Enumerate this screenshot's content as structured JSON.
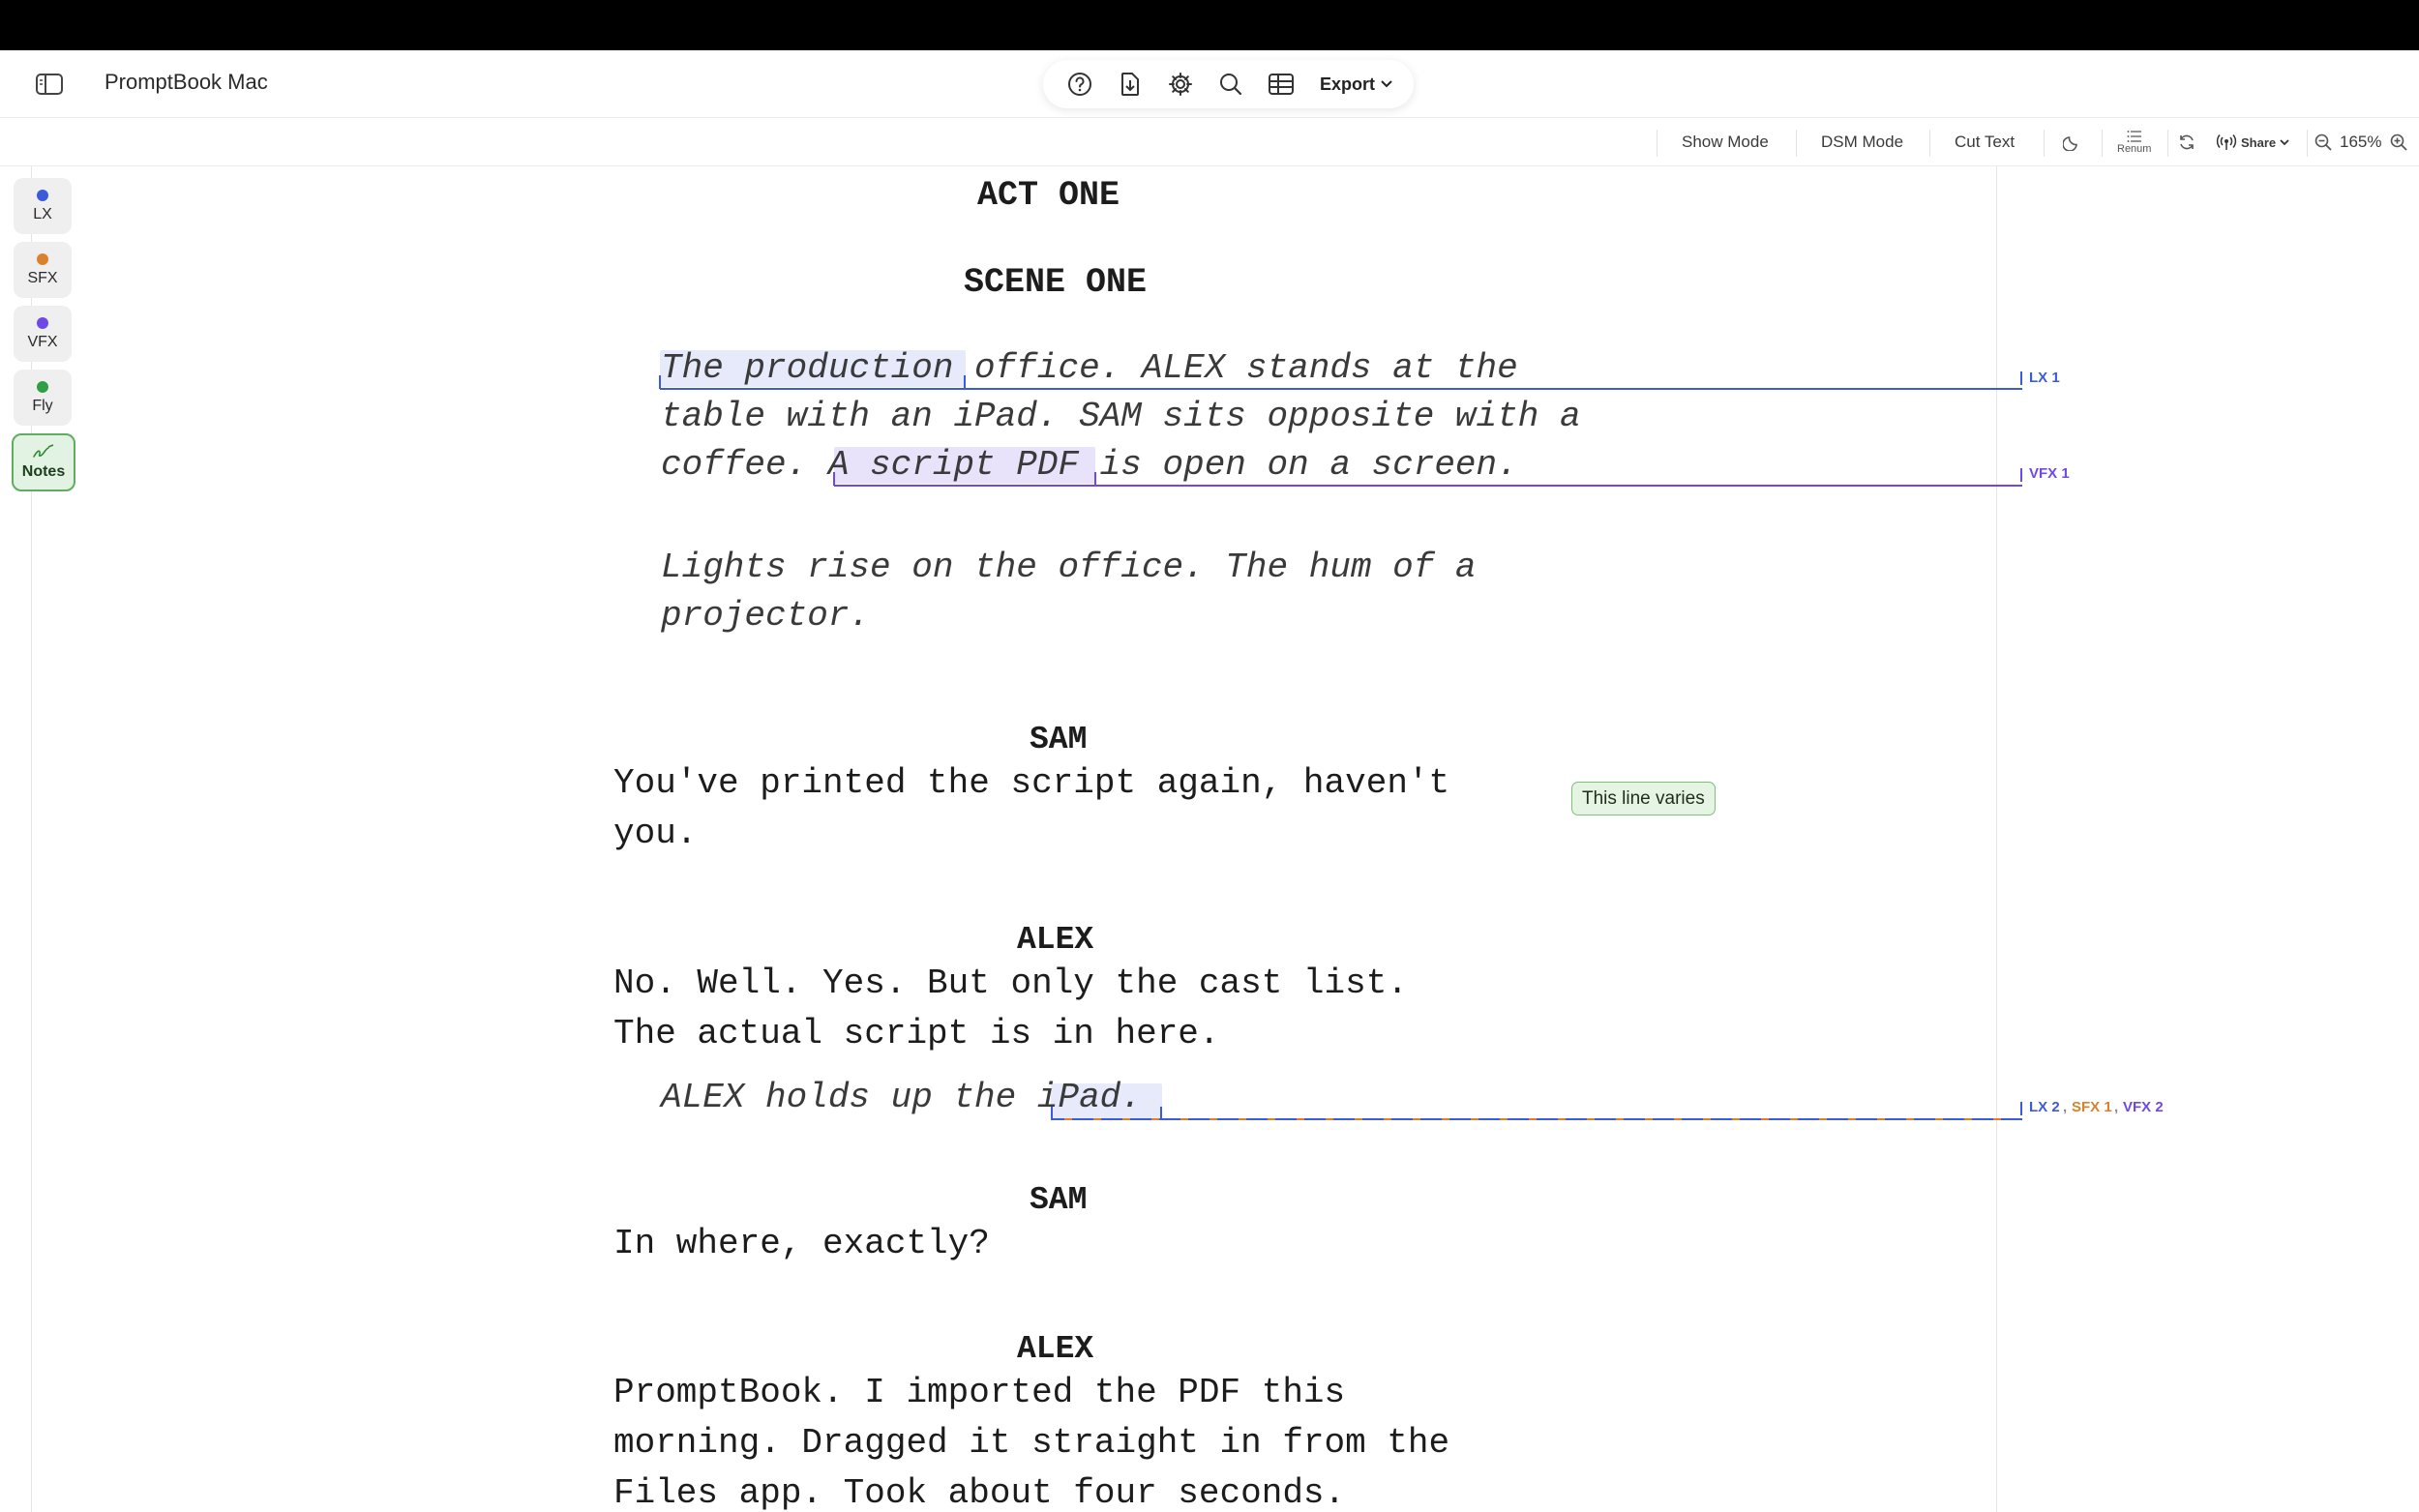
{
  "app": {
    "title": "PromptBook Mac"
  },
  "toolbar": {
    "export_label": "Export",
    "icons": [
      "help-icon",
      "import-icon",
      "gear-icon",
      "search-icon",
      "table-icon"
    ]
  },
  "toolbar2": {
    "show_mode": "Show Mode",
    "dsm_mode": "DSM Mode",
    "cut_text": "Cut Text",
    "renum": "Renum",
    "share": "Share",
    "zoom": "165%"
  },
  "categories": [
    {
      "label": "LX",
      "color": "#3b5bdb"
    },
    {
      "label": "SFX",
      "color": "#d9822b"
    },
    {
      "label": "VFX",
      "color": "#7048e8"
    },
    {
      "label": "Fly",
      "color": "#2f9e44"
    }
  ],
  "notes_label": "Notes",
  "script": {
    "act": "ACT ONE",
    "scene": "SCENE ONE",
    "stage1": "The production office. ALEX stands at the\ntable with an iPad. SAM sits opposite with a\ncoffee. A script PDF is open on a screen.",
    "stage2": "Lights rise on the office. The hum of a\nprojector.",
    "char1": "SAM",
    "dialogue1": "You've printed the script again, haven't\nyou.",
    "char2": "ALEX",
    "dialogue2": "No. Well. Yes. But only the cast list.\nThe actual script is in here.",
    "stage3": "ALEX holds up the iPad.",
    "char3": "SAM",
    "dialogue3": "In where, exactly?",
    "char4": "ALEX",
    "dialogue4": "PromptBook. I imported the PDF this\nmorning. Dragged it straight in from the\nFiles app. Took about four seconds."
  },
  "cues": {
    "lx1": "LX 1",
    "vfx1": "VFX 1",
    "lx2": "LX 2",
    "sfx1": "SFX 1",
    "vfx2": "VFX 2",
    "sep": ","
  },
  "note": {
    "text": "This line varies"
  },
  "colors": {
    "lx": "#3b5bdb",
    "sfx": "#d9822b",
    "vfx": "#7048e8",
    "note_bg": "#e6f4e4"
  }
}
